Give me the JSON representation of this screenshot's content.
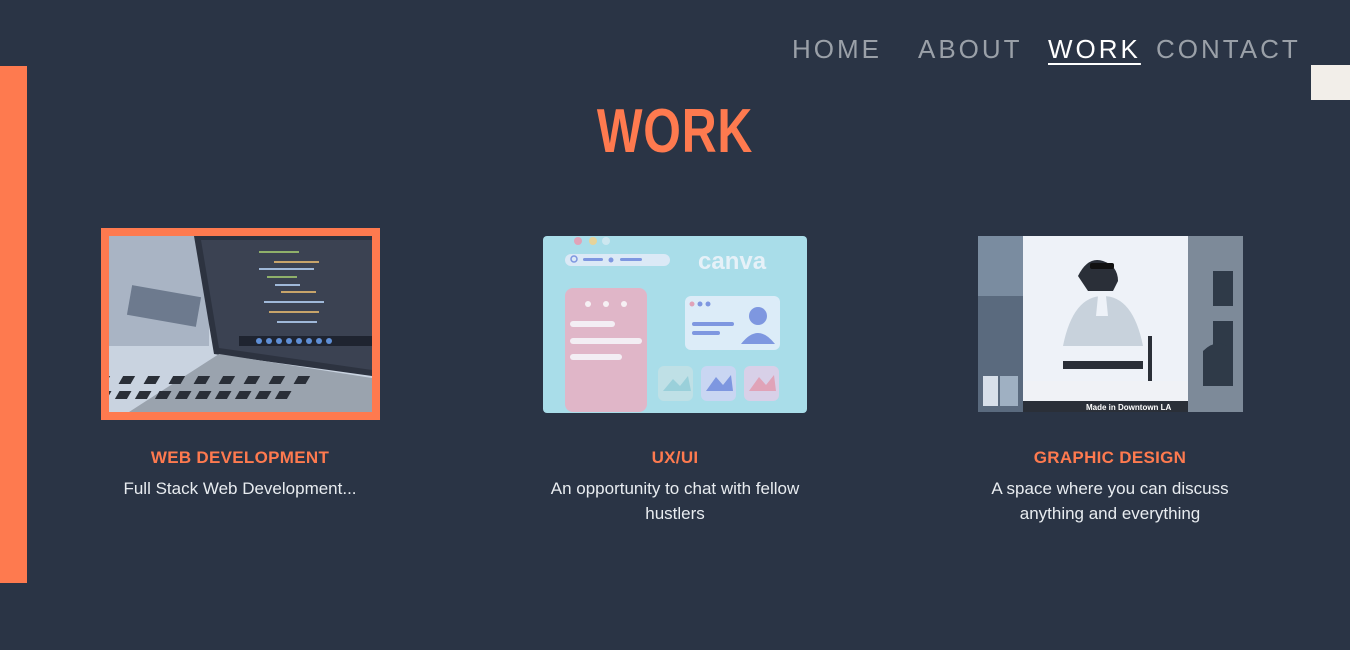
{
  "nav": {
    "home": "HOME",
    "about": "ABOUT",
    "work": "WORK",
    "contact": "CONTACT",
    "active": "work"
  },
  "page": {
    "title": "WORK"
  },
  "colors": {
    "background": "#2a3445",
    "accent": "#fe7a4f",
    "nav_inactive": "#9aa0a8",
    "text": "#e8ecf0"
  },
  "cards": [
    {
      "title": "WEB DEVELOPMENT",
      "description": "Full Stack Web Development...",
      "image": "laptop-code-image",
      "selected": true
    },
    {
      "title": "UX/UI",
      "description": "An opportunity to chat with fellow hustlers",
      "image": "canva-illustration-image",
      "image_caption": "canva",
      "selected": false
    },
    {
      "title": "GRAPHIC DESIGN",
      "description": "A space where you can discuss anything and everything",
      "image": "billboard-photo-image",
      "image_caption": "Made in Downtown LA",
      "selected": false
    }
  ]
}
